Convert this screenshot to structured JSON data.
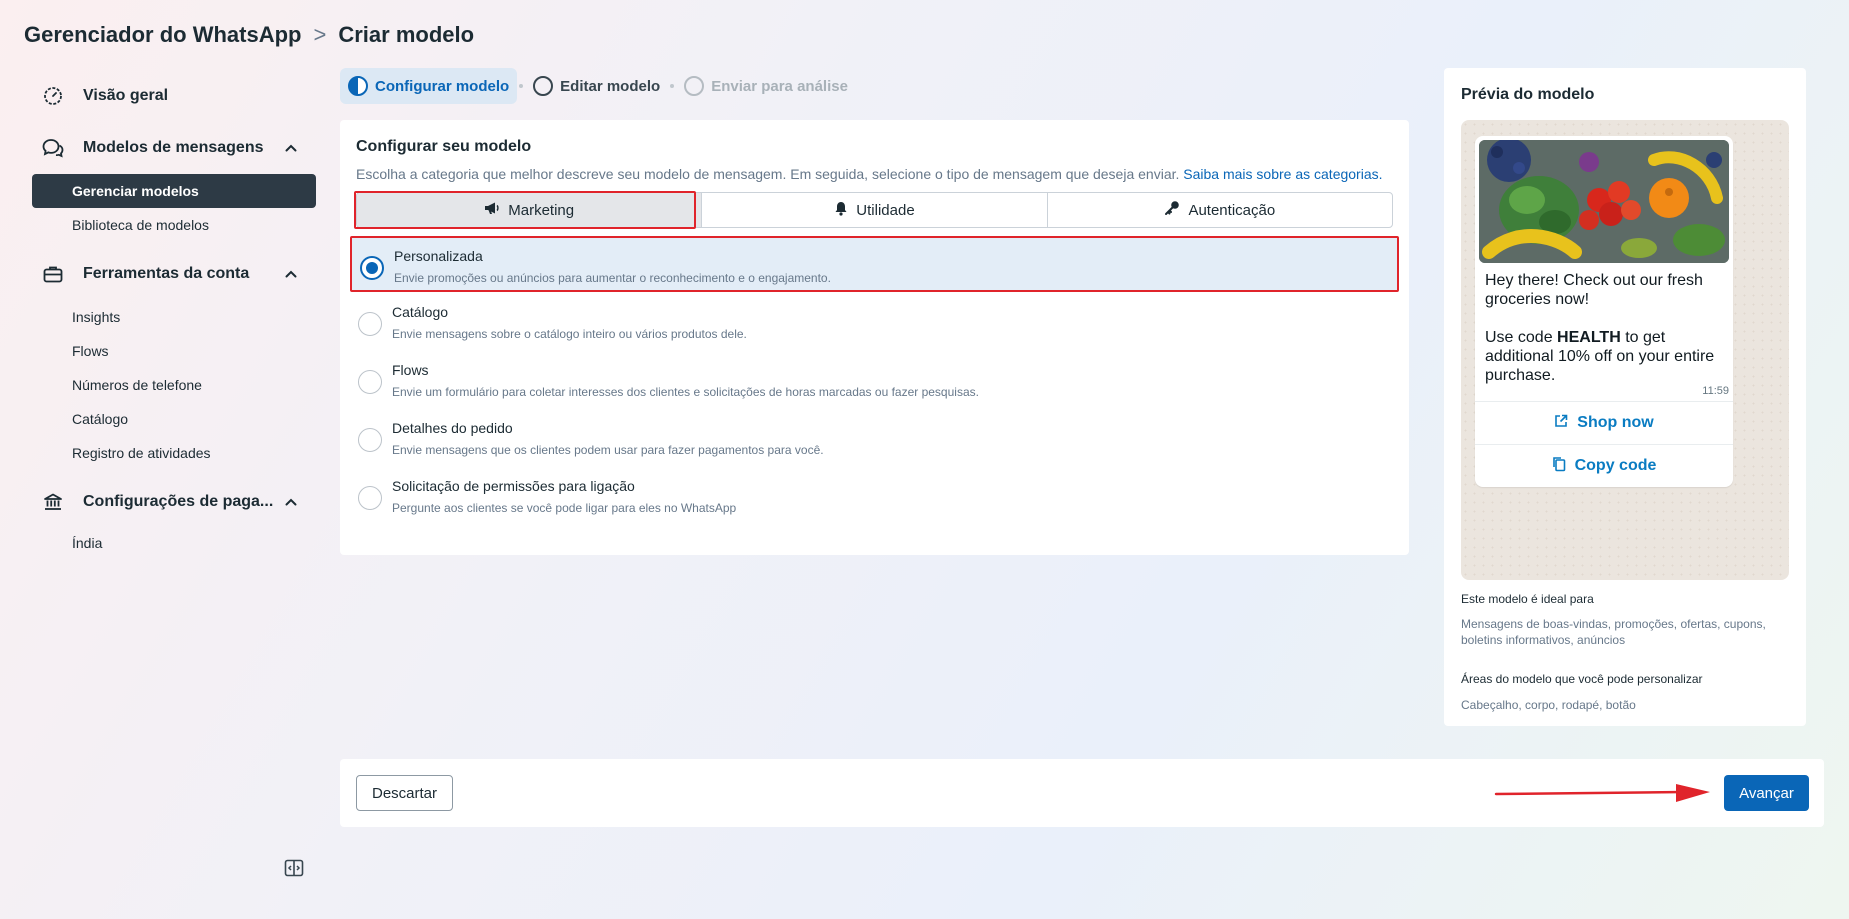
{
  "header": {
    "app": "Gerenciador do WhatsApp",
    "separator": ">",
    "page": "Criar modelo"
  },
  "sidebar": {
    "overview": "Visão geral",
    "templates_section": "Modelos de mensagens",
    "templates_items": [
      "Gerenciar modelos",
      "Biblioteca de modelos"
    ],
    "tools_section": "Ferramentas da conta",
    "tools_items": [
      "Insights",
      "Flows",
      "Números de telefone",
      "Catálogo",
      "Registro de atividades"
    ],
    "payments_section": "Configurações de paga...",
    "payments_items": [
      "Índia"
    ]
  },
  "stepper": {
    "steps": [
      "Configurar modelo",
      "Editar modelo",
      "Enviar para análise"
    ]
  },
  "setup": {
    "title": "Configurar seu modelo",
    "description": "Escolha a categoria que melhor descreve seu modelo de mensagem. Em seguida, selecione o tipo de mensagem que deseja enviar.",
    "learn_more": "Saiba mais sobre as categorias.",
    "tabs": [
      "Marketing",
      "Utilidade",
      "Autenticação"
    ],
    "selected_tab": "Marketing",
    "options": [
      {
        "title": "Personalizada",
        "desc": "Envie promoções ou anúncios para aumentar o reconhecimento e o engajamento."
      },
      {
        "title": "Catálogo",
        "desc": "Envie mensagens sobre o catálogo inteiro ou vários produtos dele."
      },
      {
        "title": "Flows",
        "desc": "Envie um formulário para coletar interesses dos clientes e solicitações de horas marcadas ou fazer pesquisas."
      },
      {
        "title": "Detalhes do pedido",
        "desc": "Envie mensagens que os clientes podem usar para fazer pagamentos para você."
      },
      {
        "title": "Solicitação de permissões para ligação",
        "desc": "Pergunte aos clientes se você pode ligar para eles no WhatsApp"
      }
    ],
    "selected_option": "Personalizada"
  },
  "preview": {
    "title": "Prévia do modelo",
    "msg_line1": "Hey there! Check out our fresh groceries now!",
    "msg_pre": "Use code ",
    "msg_code": "HEALTH",
    "msg_post": " to get additional 10% off on your entire purchase.",
    "time": "11:59",
    "btn_shop": "Shop now",
    "btn_copy": "Copy code",
    "ideal_title": "Este modelo é ideal para",
    "ideal_text": "Mensagens de boas-vindas, promoções, ofertas, cupons, boletins informativos, anúncios",
    "areas_title": "Áreas do modelo que você pode personalizar",
    "areas_text": "Cabeçalho, corpo, rodapé, botão"
  },
  "footer": {
    "discard": "Descartar",
    "next": "Avançar"
  },
  "colors": {
    "accent": "#0a66b7",
    "highlight": "#e0242b",
    "sidebar_active": "#2d3a45"
  }
}
